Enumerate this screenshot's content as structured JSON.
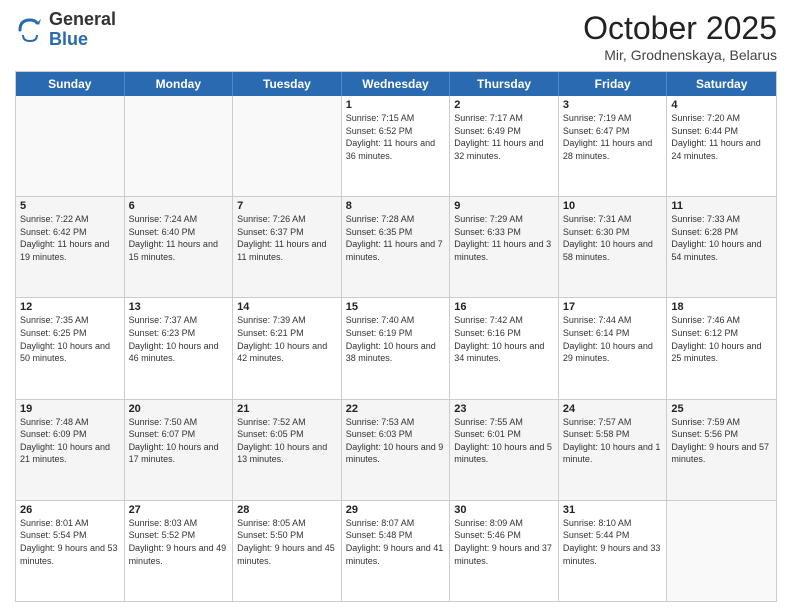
{
  "header": {
    "logo_general": "General",
    "logo_blue": "Blue",
    "title": "October 2025",
    "location": "Mir, Grodnenskaya, Belarus"
  },
  "day_headers": [
    "Sunday",
    "Monday",
    "Tuesday",
    "Wednesday",
    "Thursday",
    "Friday",
    "Saturday"
  ],
  "weeks": [
    [
      {
        "day": "",
        "info": ""
      },
      {
        "day": "",
        "info": ""
      },
      {
        "day": "",
        "info": ""
      },
      {
        "day": "1",
        "info": "Sunrise: 7:15 AM\nSunset: 6:52 PM\nDaylight: 11 hours\nand 36 minutes."
      },
      {
        "day": "2",
        "info": "Sunrise: 7:17 AM\nSunset: 6:49 PM\nDaylight: 11 hours\nand 32 minutes."
      },
      {
        "day": "3",
        "info": "Sunrise: 7:19 AM\nSunset: 6:47 PM\nDaylight: 11 hours\nand 28 minutes."
      },
      {
        "day": "4",
        "info": "Sunrise: 7:20 AM\nSunset: 6:44 PM\nDaylight: 11 hours\nand 24 minutes."
      }
    ],
    [
      {
        "day": "5",
        "info": "Sunrise: 7:22 AM\nSunset: 6:42 PM\nDaylight: 11 hours\nand 19 minutes."
      },
      {
        "day": "6",
        "info": "Sunrise: 7:24 AM\nSunset: 6:40 PM\nDaylight: 11 hours\nand 15 minutes."
      },
      {
        "day": "7",
        "info": "Sunrise: 7:26 AM\nSunset: 6:37 PM\nDaylight: 11 hours\nand 11 minutes."
      },
      {
        "day": "8",
        "info": "Sunrise: 7:28 AM\nSunset: 6:35 PM\nDaylight: 11 hours\nand 7 minutes."
      },
      {
        "day": "9",
        "info": "Sunrise: 7:29 AM\nSunset: 6:33 PM\nDaylight: 11 hours\nand 3 minutes."
      },
      {
        "day": "10",
        "info": "Sunrise: 7:31 AM\nSunset: 6:30 PM\nDaylight: 10 hours\nand 58 minutes."
      },
      {
        "day": "11",
        "info": "Sunrise: 7:33 AM\nSunset: 6:28 PM\nDaylight: 10 hours\nand 54 minutes."
      }
    ],
    [
      {
        "day": "12",
        "info": "Sunrise: 7:35 AM\nSunset: 6:25 PM\nDaylight: 10 hours\nand 50 minutes."
      },
      {
        "day": "13",
        "info": "Sunrise: 7:37 AM\nSunset: 6:23 PM\nDaylight: 10 hours\nand 46 minutes."
      },
      {
        "day": "14",
        "info": "Sunrise: 7:39 AM\nSunset: 6:21 PM\nDaylight: 10 hours\nand 42 minutes."
      },
      {
        "day": "15",
        "info": "Sunrise: 7:40 AM\nSunset: 6:19 PM\nDaylight: 10 hours\nand 38 minutes."
      },
      {
        "day": "16",
        "info": "Sunrise: 7:42 AM\nSunset: 6:16 PM\nDaylight: 10 hours\nand 34 minutes."
      },
      {
        "day": "17",
        "info": "Sunrise: 7:44 AM\nSunset: 6:14 PM\nDaylight: 10 hours\nand 29 minutes."
      },
      {
        "day": "18",
        "info": "Sunrise: 7:46 AM\nSunset: 6:12 PM\nDaylight: 10 hours\nand 25 minutes."
      }
    ],
    [
      {
        "day": "19",
        "info": "Sunrise: 7:48 AM\nSunset: 6:09 PM\nDaylight: 10 hours\nand 21 minutes."
      },
      {
        "day": "20",
        "info": "Sunrise: 7:50 AM\nSunset: 6:07 PM\nDaylight: 10 hours\nand 17 minutes."
      },
      {
        "day": "21",
        "info": "Sunrise: 7:52 AM\nSunset: 6:05 PM\nDaylight: 10 hours\nand 13 minutes."
      },
      {
        "day": "22",
        "info": "Sunrise: 7:53 AM\nSunset: 6:03 PM\nDaylight: 10 hours\nand 9 minutes."
      },
      {
        "day": "23",
        "info": "Sunrise: 7:55 AM\nSunset: 6:01 PM\nDaylight: 10 hours\nand 5 minutes."
      },
      {
        "day": "24",
        "info": "Sunrise: 7:57 AM\nSunset: 5:58 PM\nDaylight: 10 hours\nand 1 minute."
      },
      {
        "day": "25",
        "info": "Sunrise: 7:59 AM\nSunset: 5:56 PM\nDaylight: 9 hours\nand 57 minutes."
      }
    ],
    [
      {
        "day": "26",
        "info": "Sunrise: 8:01 AM\nSunset: 5:54 PM\nDaylight: 9 hours\nand 53 minutes."
      },
      {
        "day": "27",
        "info": "Sunrise: 8:03 AM\nSunset: 5:52 PM\nDaylight: 9 hours\nand 49 minutes."
      },
      {
        "day": "28",
        "info": "Sunrise: 8:05 AM\nSunset: 5:50 PM\nDaylight: 9 hours\nand 45 minutes."
      },
      {
        "day": "29",
        "info": "Sunrise: 8:07 AM\nSunset: 5:48 PM\nDaylight: 9 hours\nand 41 minutes."
      },
      {
        "day": "30",
        "info": "Sunrise: 8:09 AM\nSunset: 5:46 PM\nDaylight: 9 hours\nand 37 minutes."
      },
      {
        "day": "31",
        "info": "Sunrise: 8:10 AM\nSunset: 5:44 PM\nDaylight: 9 hours\nand 33 minutes."
      },
      {
        "day": "",
        "info": ""
      }
    ]
  ]
}
